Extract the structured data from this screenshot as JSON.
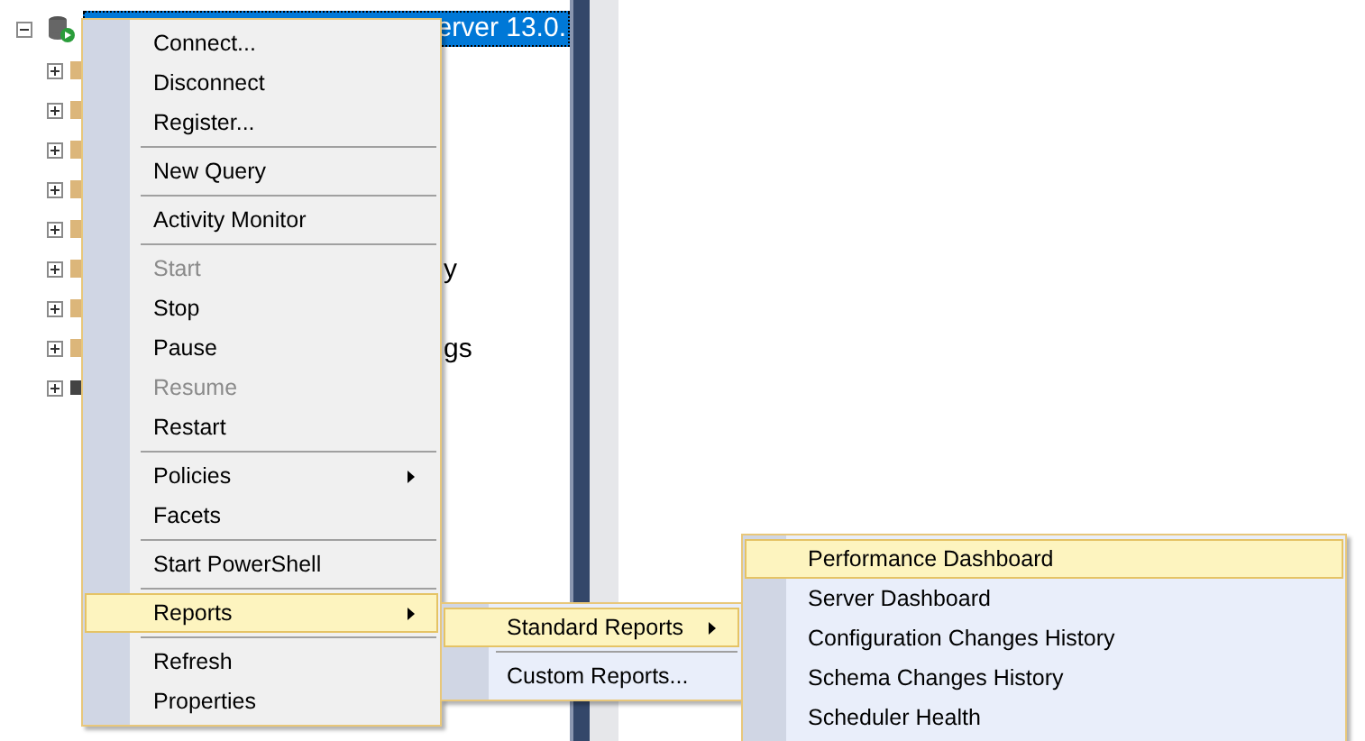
{
  "object_explorer": {
    "root": {
      "label": "erver 13.0.",
      "expanded": true,
      "selected": true
    },
    "children": [
      {
        "kind": "folder",
        "expanded": false
      },
      {
        "kind": "folder",
        "expanded": false
      },
      {
        "kind": "folder",
        "expanded": false
      },
      {
        "kind": "folder",
        "expanded": false
      },
      {
        "kind": "folder",
        "expanded": false
      },
      {
        "kind": "folder",
        "expanded": false,
        "label": "y"
      },
      {
        "kind": "folder",
        "expanded": false
      },
      {
        "kind": "folder",
        "expanded": false,
        "label": "gs"
      },
      {
        "kind": "node",
        "expanded": false
      }
    ]
  },
  "context_menu": [
    {
      "kind": "item",
      "label": "Connect...",
      "disabled": false,
      "submenu": false,
      "selected": false
    },
    {
      "kind": "item",
      "label": "Disconnect",
      "disabled": false,
      "submenu": false,
      "selected": false
    },
    {
      "kind": "item",
      "label": "Register...",
      "disabled": false,
      "submenu": false,
      "selected": false
    },
    {
      "kind": "separator"
    },
    {
      "kind": "item",
      "label": "New Query",
      "disabled": false,
      "submenu": false,
      "selected": false
    },
    {
      "kind": "separator"
    },
    {
      "kind": "item",
      "label": "Activity Monitor",
      "disabled": false,
      "submenu": false,
      "selected": false
    },
    {
      "kind": "separator"
    },
    {
      "kind": "item",
      "label": "Start",
      "disabled": true,
      "submenu": false,
      "selected": false
    },
    {
      "kind": "item",
      "label": "Stop",
      "disabled": false,
      "submenu": false,
      "selected": false
    },
    {
      "kind": "item",
      "label": "Pause",
      "disabled": false,
      "submenu": false,
      "selected": false
    },
    {
      "kind": "item",
      "label": "Resume",
      "disabled": true,
      "submenu": false,
      "selected": false
    },
    {
      "kind": "item",
      "label": "Restart",
      "disabled": false,
      "submenu": false,
      "selected": false
    },
    {
      "kind": "separator"
    },
    {
      "kind": "item",
      "label": "Policies",
      "disabled": false,
      "submenu": true,
      "selected": false
    },
    {
      "kind": "item",
      "label": "Facets",
      "disabled": false,
      "submenu": false,
      "selected": false
    },
    {
      "kind": "separator"
    },
    {
      "kind": "item",
      "label": "Start PowerShell",
      "disabled": false,
      "submenu": false,
      "selected": false
    },
    {
      "kind": "separator"
    },
    {
      "kind": "item",
      "label": "Reports",
      "disabled": false,
      "submenu": true,
      "selected": true
    },
    {
      "kind": "separator"
    },
    {
      "kind": "item",
      "label": "Refresh",
      "disabled": false,
      "submenu": false,
      "selected": false
    },
    {
      "kind": "item",
      "label": "Properties",
      "disabled": false,
      "submenu": false,
      "selected": false
    }
  ],
  "reports_submenu": [
    {
      "kind": "item",
      "label": "Standard Reports",
      "disabled": false,
      "submenu": true,
      "selected": true
    },
    {
      "kind": "separator"
    },
    {
      "kind": "item",
      "label": "Custom Reports...",
      "disabled": false,
      "submenu": false,
      "selected": false
    }
  ],
  "standard_reports_submenu": [
    {
      "kind": "item",
      "label": "Performance Dashboard",
      "disabled": false,
      "submenu": false,
      "selected": true
    },
    {
      "kind": "item",
      "label": "Server Dashboard",
      "disabled": false,
      "submenu": false,
      "selected": false
    },
    {
      "kind": "item",
      "label": "Configuration Changes History",
      "disabled": false,
      "submenu": false,
      "selected": false
    },
    {
      "kind": "item",
      "label": "Schema Changes History",
      "disabled": false,
      "submenu": false,
      "selected": false
    },
    {
      "kind": "item",
      "label": "Scheduler Health",
      "disabled": false,
      "submenu": false,
      "selected": false
    }
  ]
}
